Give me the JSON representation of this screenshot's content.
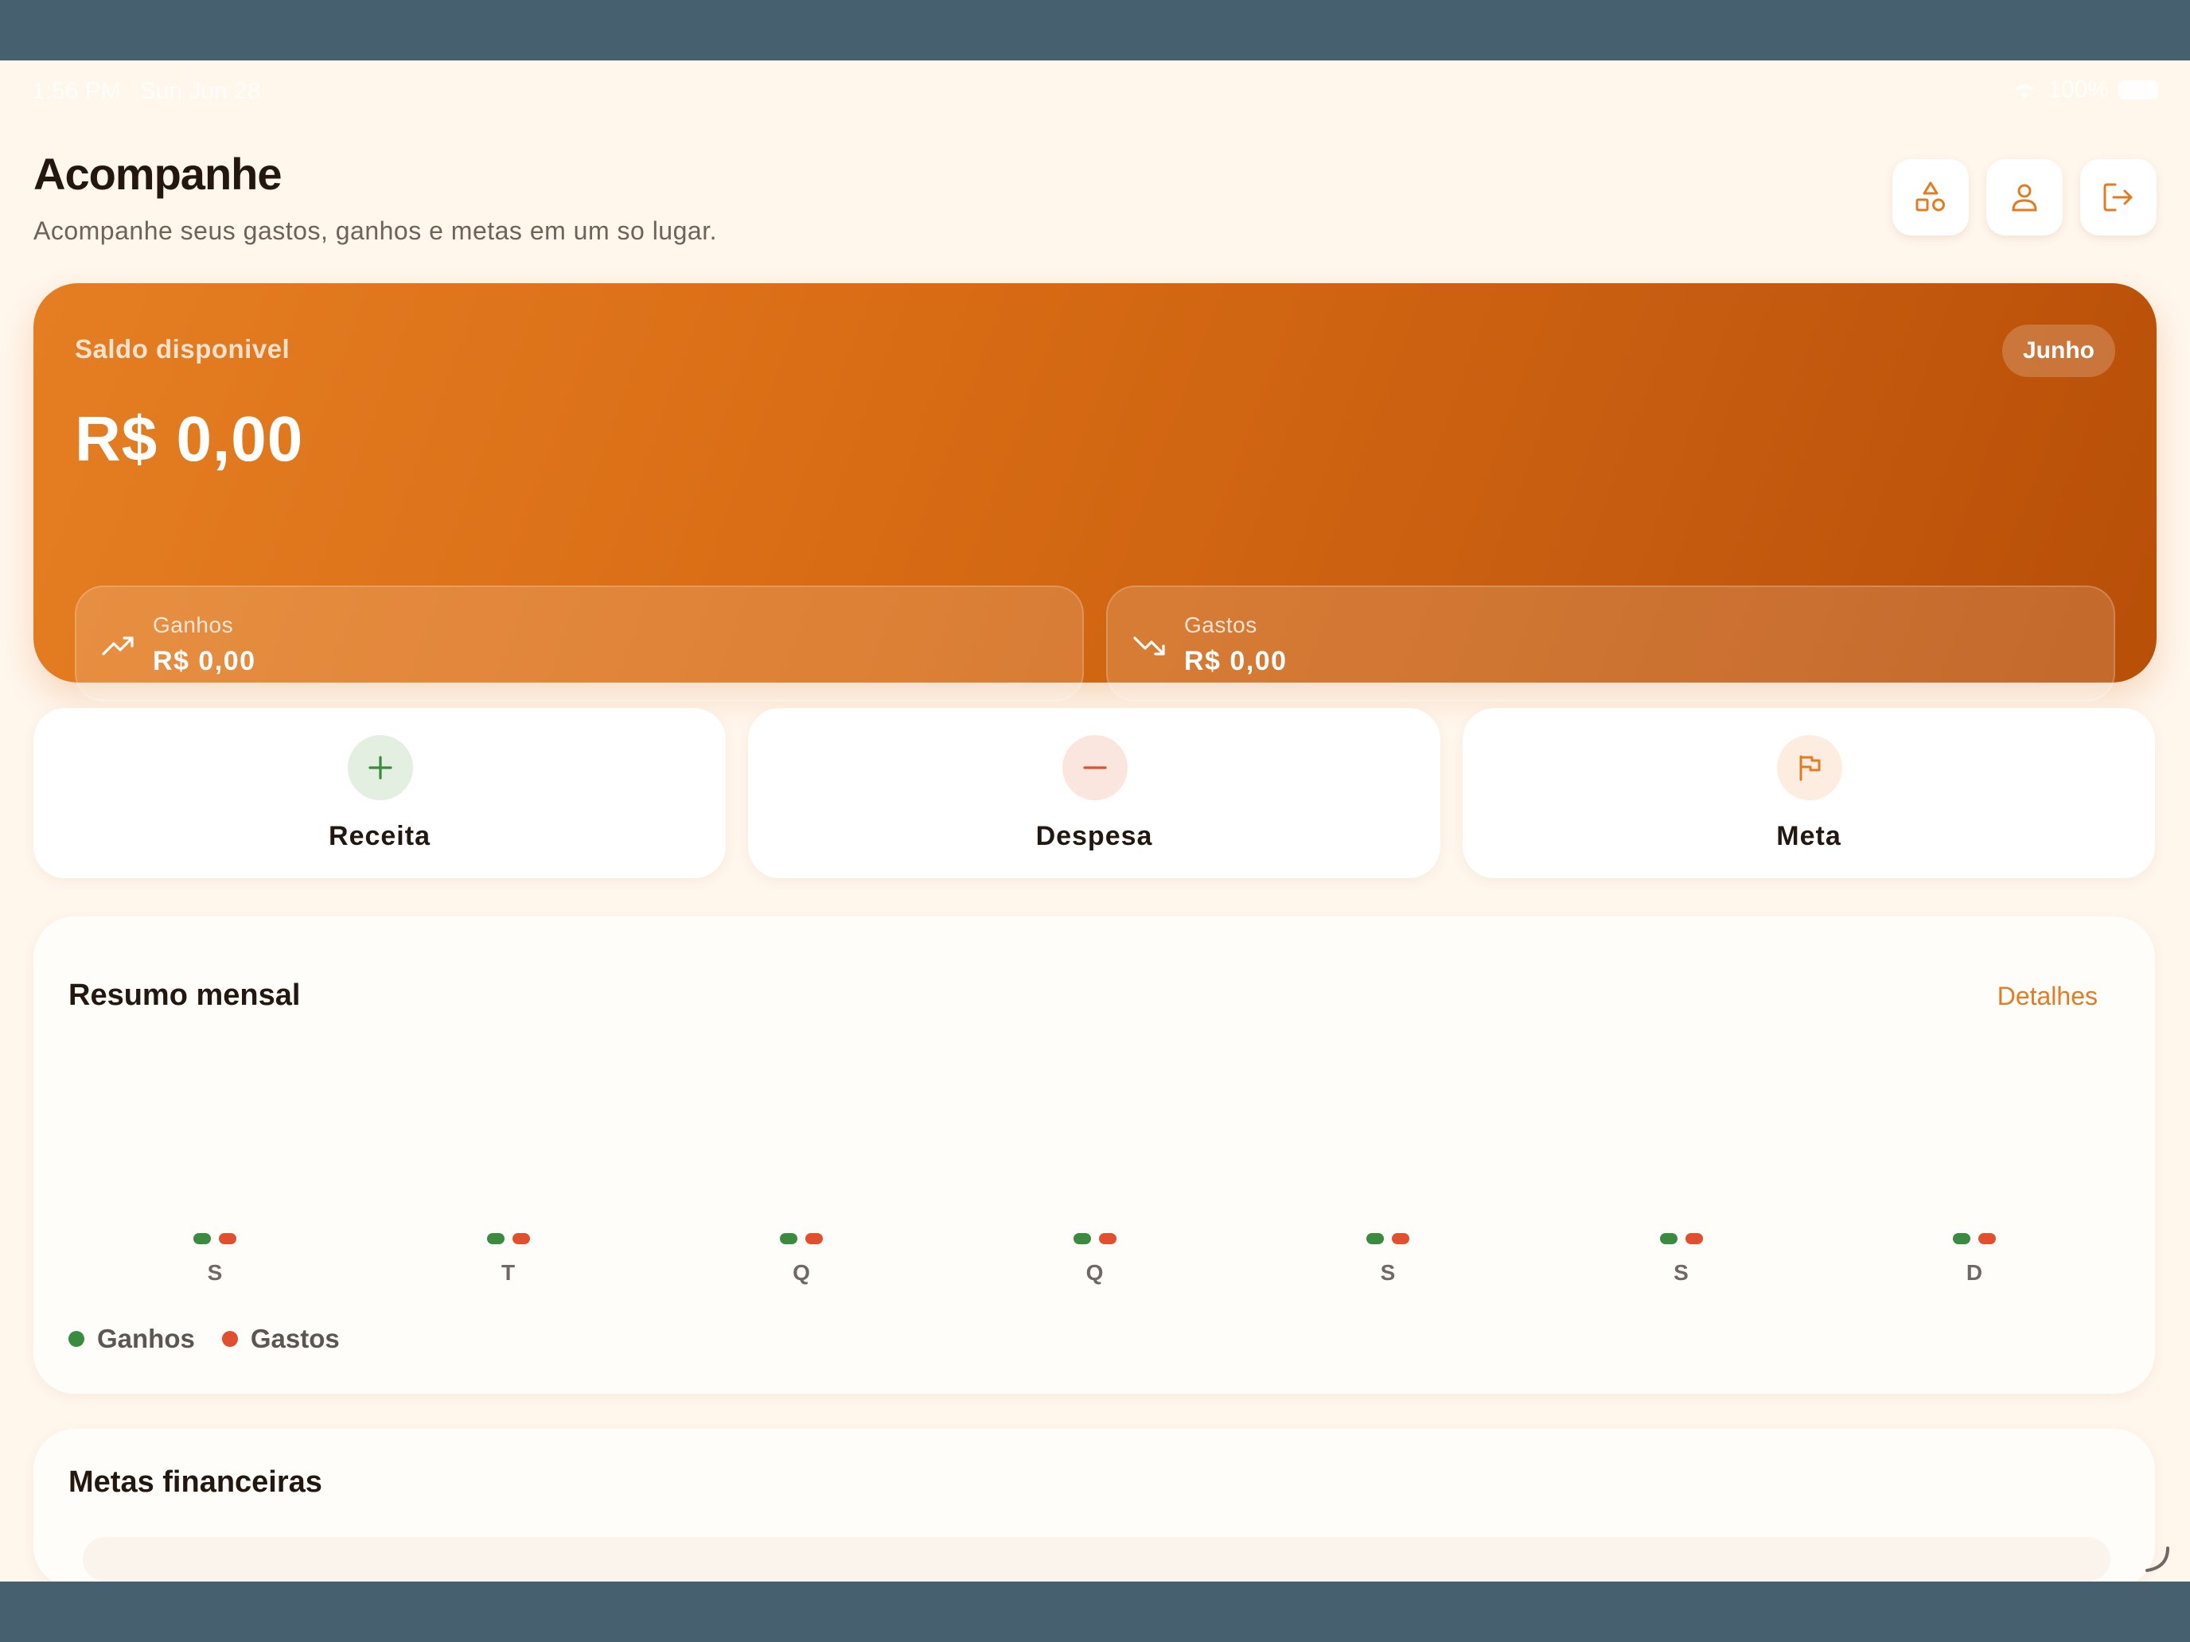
{
  "status_bar": {
    "time": "1:56 PM",
    "date": "Sun Jun 28",
    "battery": "100%"
  },
  "header": {
    "title": "Acompanhe",
    "subtitle": "Acompanhe seus gastos, ganhos e metas em um so lugar.",
    "buttons": [
      {
        "icon": "shapes-icon"
      },
      {
        "icon": "person-icon"
      },
      {
        "icon": "logout-icon"
      }
    ]
  },
  "balance": {
    "label": "Saldo disponivel",
    "month": "Junho",
    "value": "R$ 0,00",
    "income": {
      "label": "Ganhos",
      "value": "R$ 0,00",
      "icon": "trending-up-icon"
    },
    "expense": {
      "label": "Gastos",
      "value": "R$ 0,00",
      "icon": "trending-down-icon"
    }
  },
  "actions": [
    {
      "label": "Receita",
      "icon": "plus-icon",
      "color": "#3a8a40"
    },
    {
      "label": "Despesa",
      "icon": "minus-icon",
      "color": "#e0502e"
    },
    {
      "label": "Meta",
      "icon": "flag-icon",
      "color": "#e07c23"
    }
  ],
  "summary": {
    "title": "Resumo mensal",
    "link": "Detalhes",
    "days": [
      "S",
      "T",
      "Q",
      "Q",
      "S",
      "S",
      "D"
    ],
    "legend": {
      "income": "Ganhos",
      "expense": "Gastos"
    }
  },
  "chart_data": {
    "type": "bar",
    "categories": [
      "S",
      "T",
      "Q",
      "Q",
      "S",
      "S",
      "D"
    ],
    "series": [
      {
        "name": "Ganhos",
        "values": [
          0,
          0,
          0,
          0,
          0,
          0,
          0
        ]
      },
      {
        "name": "Gastos",
        "values": [
          0,
          0,
          0,
          0,
          0,
          0,
          0
        ]
      }
    ],
    "title": "Resumo mensal",
    "legend": "bottom-left"
  },
  "goals": {
    "title": "Metas financeiras"
  },
  "colors": {
    "accent": "#e07c23",
    "income": "#3a8a40",
    "expense": "#e0502e",
    "background": "#fff6ec"
  }
}
